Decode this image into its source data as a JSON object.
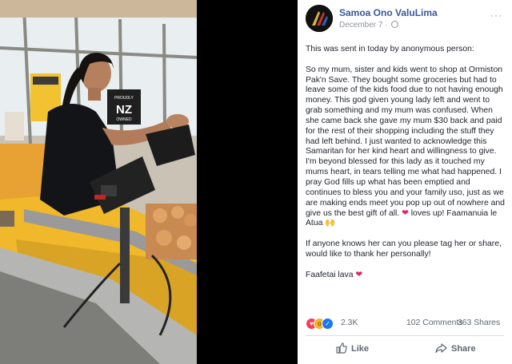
{
  "post": {
    "author": "Samoa Ono ValuLima",
    "date": "December 7",
    "separator": "·",
    "more_label": "···",
    "paragraphs": [
      "This was sent in today by anonymous person:",
      "So my mum, sister and kids went to shop at Ormiston Pak'n Save. They bought some groceries but had to leave some of the kids food due to not having enough money. This god given young lady left and went to grab something and my mum was confused. When she came back she gave my mum $30 back and paid for the rest of their shopping including the stuff they had left behind. I just wanted to acknowledge this Samaritan for her kind heart and willingness to give. I'm beyond blessed for this lady as it touched my mums heart, in tears telling me what had happened. I pray God fills up what has been emptied and continues to bless you and your family uso, just as we are making ends meet you pop up out of nowhere and give us the best gift of all.",
      "If anyone knows her can you please tag her or share, would like to thank her personally!"
    ],
    "heart_suffix": "loves up! Faamanuia le Atua",
    "closing": "Faafetai lava",
    "heart_glyph": "❤",
    "hands_glyph": "🙌"
  },
  "photo": {
    "sign_line1": "PROUDLY",
    "sign_line2": "NZ",
    "sign_line3": "OWNED"
  },
  "stats": {
    "reaction_count": "2.3K",
    "comments": "102 Comments",
    "shares": "363 Shares",
    "reactions": [
      "love",
      "wow",
      "like"
    ]
  },
  "actions": {
    "like_label": "Like",
    "share_label": "Share"
  },
  "colors": {
    "name": "#385898",
    "love": "#f33e58",
    "like": "#1877f2",
    "wow": "#f7b125",
    "muted": "#606770"
  }
}
